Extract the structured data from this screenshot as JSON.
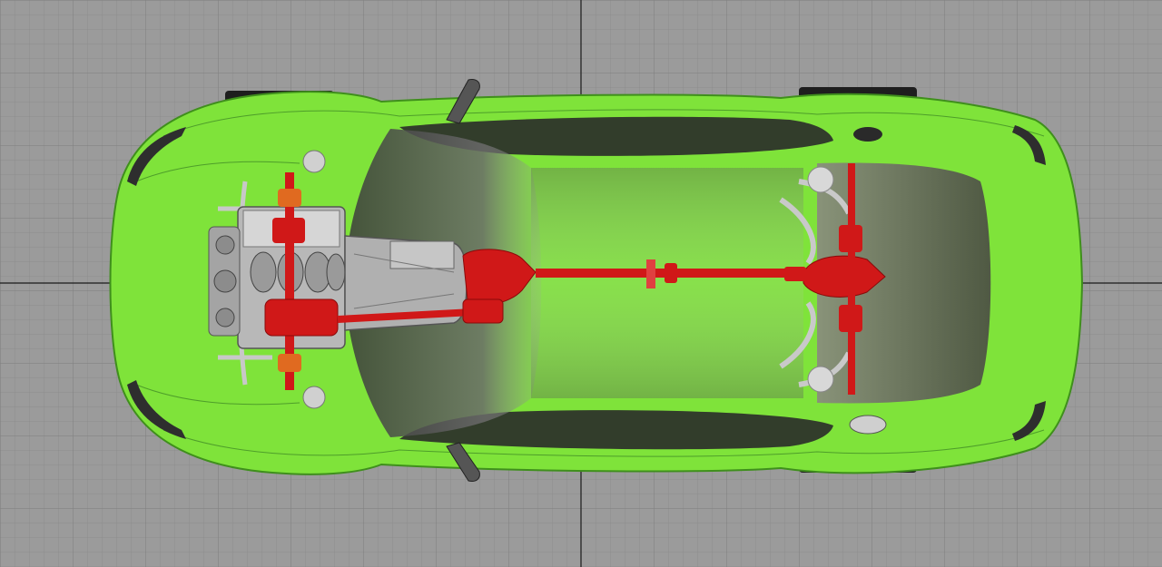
{
  "viewport": {
    "view": "top-view",
    "colors": {
      "background": "#9b9b9b",
      "grid_minor": "#8c8c8c",
      "grid_major": "#7e7e7e",
      "axis": "#1a1a1a",
      "body": "#7fe33a",
      "body_edge": "#3f8f1c",
      "glass": "#2a2a2a",
      "drivetrain": "#d01818",
      "engine": "#b8b8b8"
    },
    "icons": [
      "car-body",
      "windshield",
      "engine-block",
      "gearbox",
      "driveshaft",
      "rear-differential",
      "front-axle",
      "rear-axle",
      "side-mirror",
      "wheel"
    ]
  }
}
